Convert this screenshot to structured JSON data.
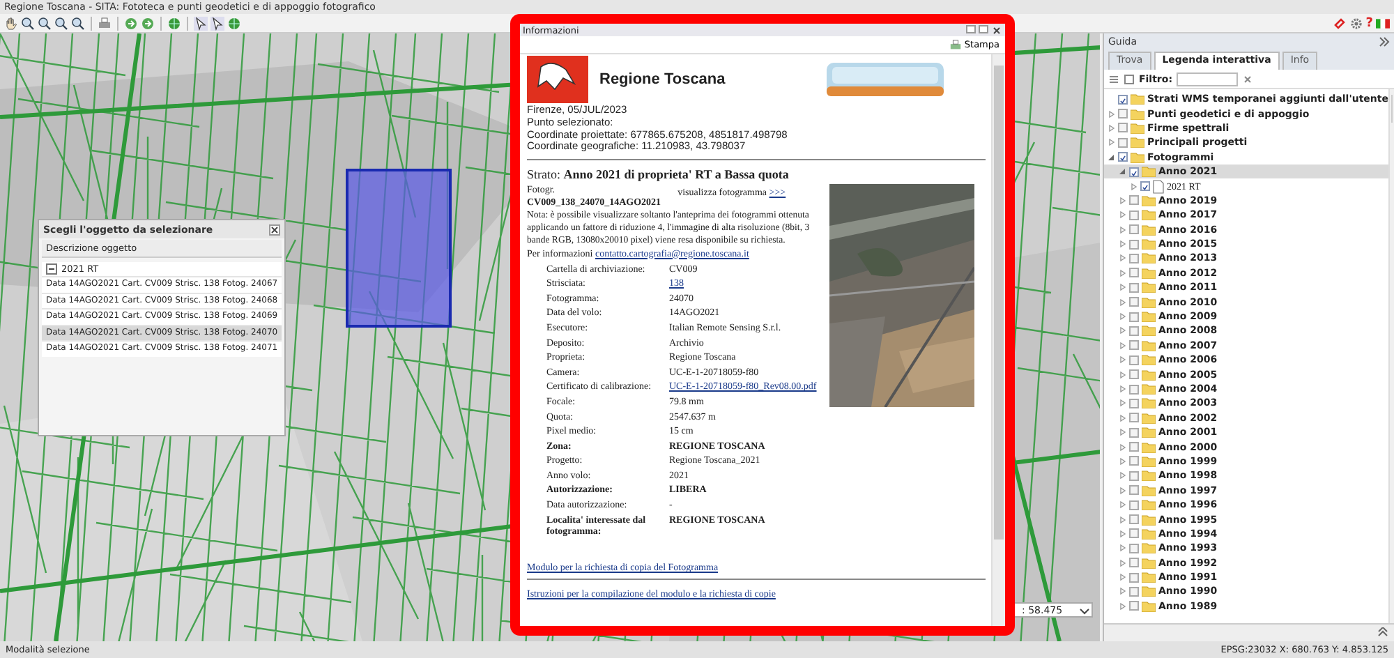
{
  "window": {
    "title": "Regione Toscana - SITA: Fototeca e punti geodetici e di appoggio fotografico"
  },
  "toolbar": {
    "help_label": "?"
  },
  "map": {
    "kind": "picture",
    "scale": ": 58.475"
  },
  "select_dialog": {
    "title": "Scegli l'oggetto da selezionare",
    "column": "Descrizione oggetto",
    "group": "2021 RT",
    "rows": [
      {
        "text": "Data 14AGO2021 Cart. CV009 Strisc. 138 Fotog. 24067",
        "selected": false
      },
      {
        "text": "Data 14AGO2021 Cart. CV009 Strisc. 138 Fotog. 24068",
        "selected": false
      },
      {
        "text": "Data 14AGO2021 Cart. CV009 Strisc. 138 Fotog. 24069",
        "selected": false
      },
      {
        "text": "Data 14AGO2021 Cart. CV009 Strisc. 138 Fotog. 24070",
        "selected": true
      },
      {
        "text": "Data 14AGO2021 Cart. CV009 Strisc. 138 Fotog. 24071",
        "selected": false
      }
    ]
  },
  "info_window": {
    "title": "Informazioni",
    "print_button": "Stampa",
    "header": "Regione Toscana",
    "lines": [
      "Firenze, 05/JUL/2023",
      "Punto selezionato:",
      "Coordinate proiettate: 677865.675208, 4851817.498798",
      "Coordinate geografiche: 11.210983, 43.798037"
    ],
    "layer": "Strato: **Anno 2021 di proprieta' RT a Bassa quota**",
    "photo_label": "Fotogr.",
    "photo_id": "CV009_138_24070_14AGO2021",
    "view_label": "visualizza fotogramma",
    "view_link": ">>>",
    "note": "Nota: è possibile visualizzare soltanto l'anteprima dei fotogrammi ottenuta applicando un fattore di riduzione 4, l'immagine di alta risoluzione (8bit, 3 bande RGB, 13080x20010 pixel) viene resa disponibile su richiesta.",
    "contact_label": "Per informazioni",
    "contact_link": "contatto.cartografia@regione.toscana.it",
    "photo": {
      "kind": "picture"
    },
    "fields": [
      {
        "label": "Cartella di archiviazione:",
        "value": "CV009",
        "kind": "text"
      },
      {
        "label": "Strisciata:",
        "value": "138",
        "kind": "link"
      },
      {
        "label": "Fotogramma:",
        "value": "24070",
        "kind": "text"
      },
      {
        "label": "Data del volo:",
        "value": "14AGO2021",
        "kind": "text"
      },
      {
        "label": "Esecutore:",
        "value": "Italian Remote Sensing S.r.l.",
        "kind": "text"
      },
      {
        "label": "Deposito:",
        "value": "Archivio",
        "kind": "text"
      },
      {
        "label": "Proprieta:",
        "value": "Regione Toscana",
        "kind": "text"
      },
      {
        "label": "Camera:",
        "value": "UC-E-1-20718059-f80",
        "kind": "text"
      },
      {
        "label": "Certificato di calibrazione:",
        "value": "UC-E-1-20718059-f80_Rev08.00.pdf",
        "kind": "link"
      },
      {
        "label": "Focale:",
        "value": "79.8 mm",
        "kind": "text"
      },
      {
        "label": "Quota:",
        "value": "2547.637 m",
        "kind": "text"
      },
      {
        "label": "Pixel medio:",
        "value": "15 cm",
        "kind": "text"
      },
      {
        "label": "Zona:",
        "value": "REGIONE TOSCANA",
        "kind": "bold"
      },
      {
        "label": "Progetto:",
        "value": "Regione Toscana_2021",
        "kind": "text"
      },
      {
        "label": "Anno volo:",
        "value": "2021",
        "kind": "text"
      },
      {
        "label": "Autorizzazione:",
        "value": "LIBERA",
        "kind": "bold"
      },
      {
        "label": "Data autorizzazione:",
        "value": "-",
        "kind": "text"
      },
      {
        "label": "Localita' interessate dal fotogramma:",
        "value": "REGIONE TOSCANA",
        "kind": "bold"
      }
    ],
    "links": [
      "Modulo per la richiesta di copia del Fotogramma",
      "Istruzioni per la compilazione del modulo e la richiesta di copie"
    ]
  },
  "legend": {
    "title": "Guida",
    "tabs": [
      {
        "label": "Trova",
        "selected": false
      },
      {
        "label": "Legenda interattiva",
        "selected": true
      },
      {
        "label": "Info",
        "selected": false
      }
    ],
    "filter_label": "Filtro:",
    "tree": [
      {
        "label": "Strati WMS temporanei aggiunti dall'utente",
        "kind": "folder",
        "checked": true,
        "selected": false
      },
      {
        "label": "Punti geodetici e di appoggio",
        "kind": "folder",
        "checked": false,
        "expanded": false,
        "selected": false
      },
      {
        "label": "Firme spettrali",
        "kind": "folder",
        "checked": false,
        "expanded": false,
        "selected": false
      },
      {
        "label": "Principali progetti",
        "kind": "folder",
        "checked": false,
        "expanded": false,
        "selected": false
      },
      {
        "label": "Fotogrammi",
        "kind": "folder",
        "checked": true,
        "expanded": true,
        "selected": false,
        "children": [
          {
            "label": "Anno 2021",
            "kind": "folder",
            "checked": true,
            "expanded": true,
            "selected": true,
            "children": [
              {
                "label": "2021 RT",
                "kind": "file",
                "checked": true,
                "expanded": false,
                "selected": false
              }
            ]
          },
          {
            "label": "Anno 2019",
            "kind": "folder",
            "checked": false,
            "expanded": false,
            "selected": false
          },
          {
            "label": "Anno 2017",
            "kind": "folder",
            "checked": false,
            "expanded": false,
            "selected": false
          },
          {
            "label": "Anno 2016",
            "kind": "folder",
            "checked": false,
            "expanded": false,
            "selected": false
          },
          {
            "label": "Anno 2015",
            "kind": "folder",
            "checked": false,
            "expanded": false,
            "selected": false
          },
          {
            "label": "Anno 2013",
            "kind": "folder",
            "checked": false,
            "expanded": false,
            "selected": false
          },
          {
            "label": "Anno 2012",
            "kind": "folder",
            "checked": false,
            "expanded": false,
            "selected": false
          },
          {
            "label": "Anno 2011",
            "kind": "folder",
            "checked": false,
            "expanded": false,
            "selected": false
          },
          {
            "label": "Anno 2010",
            "kind": "folder",
            "checked": false,
            "expanded": false,
            "selected": false
          },
          {
            "label": "Anno 2009",
            "kind": "folder",
            "checked": false,
            "expanded": false,
            "selected": false
          },
          {
            "label": "Anno 2008",
            "kind": "folder",
            "checked": false,
            "expanded": false,
            "selected": false
          },
          {
            "label": "Anno 2007",
            "kind": "folder",
            "checked": false,
            "expanded": false,
            "selected": false
          },
          {
            "label": "Anno 2006",
            "kind": "folder",
            "checked": false,
            "expanded": false,
            "selected": false
          },
          {
            "label": "Anno 2005",
            "kind": "folder",
            "checked": false,
            "expanded": false,
            "selected": false
          },
          {
            "label": "Anno 2004",
            "kind": "folder",
            "checked": false,
            "expanded": false,
            "selected": false
          },
          {
            "label": "Anno 2003",
            "kind": "folder",
            "checked": false,
            "expanded": false,
            "selected": false
          },
          {
            "label": "Anno 2002",
            "kind": "folder",
            "checked": false,
            "expanded": false,
            "selected": false
          },
          {
            "label": "Anno 2001",
            "kind": "folder",
            "checked": false,
            "expanded": false,
            "selected": false
          },
          {
            "label": "Anno 2000",
            "kind": "folder",
            "checked": false,
            "expanded": false,
            "selected": false
          },
          {
            "label": "Anno 1999",
            "kind": "folder",
            "checked": false,
            "expanded": false,
            "selected": false
          },
          {
            "label": "Anno 1998",
            "kind": "folder",
            "checked": false,
            "expanded": false,
            "selected": false
          },
          {
            "label": "Anno 1997",
            "kind": "folder",
            "checked": false,
            "expanded": false,
            "selected": false
          },
          {
            "label": "Anno 1996",
            "kind": "folder",
            "checked": false,
            "expanded": false,
            "selected": false
          },
          {
            "label": "Anno 1995",
            "kind": "folder",
            "checked": false,
            "expanded": false,
            "selected": false
          },
          {
            "label": "Anno 1994",
            "kind": "folder",
            "checked": false,
            "expanded": false,
            "selected": false
          },
          {
            "label": "Anno 1993",
            "kind": "folder",
            "checked": false,
            "expanded": false,
            "selected": false
          },
          {
            "label": "Anno 1992",
            "kind": "folder",
            "checked": false,
            "expanded": false,
            "selected": false
          },
          {
            "label": "Anno 1991",
            "kind": "folder",
            "checked": false,
            "expanded": false,
            "selected": false
          },
          {
            "label": "Anno 1990",
            "kind": "folder",
            "checked": false,
            "expanded": false,
            "selected": false
          },
          {
            "label": "Anno 1989",
            "kind": "folder",
            "checked": false,
            "expanded": false,
            "selected": false
          }
        ]
      }
    ]
  },
  "status_bar": {
    "mode": "Modalità selezione",
    "coordinates": "EPSG:23032 X: 680.763 Y: 4.853.125"
  }
}
